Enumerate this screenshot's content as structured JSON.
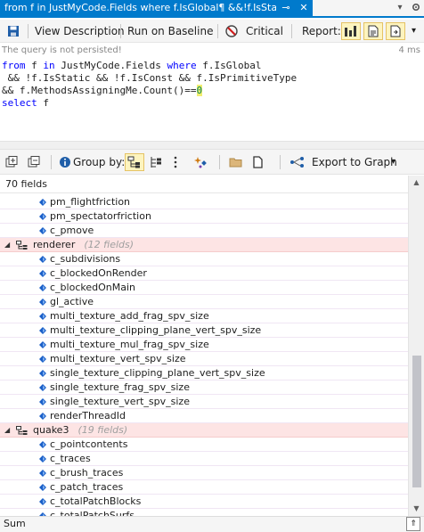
{
  "window": {
    "tab_title": "from f in JustMyCode.Fields where f.IsGlobal¶ &&!f.IsStati*",
    "pin_glyph": "⊸",
    "close_glyph": "✕"
  },
  "toolbar": {
    "view_description": "View Description",
    "run_on_baseline": "Run on Baseline",
    "critical": "Critical",
    "report_label": "Report:"
  },
  "status": {
    "message": "The query is not persisted!",
    "time": "4 ms"
  },
  "query": {
    "line1": {
      "kw1": "from",
      "a": " f ",
      "kw2": "in",
      "b": " JustMyCode.Fields ",
      "kw3": "where",
      "c": " f.IsGlobal"
    },
    "line2": " && !f.IsStatic && !f.IsConst && f.IsPrimitiveType",
    "line3": {
      "a": "&& f.MethodsAssigningMe.Count()==",
      "num": "0"
    },
    "line4": {
      "kw": "select",
      "a": " f"
    }
  },
  "results_toolbar": {
    "group_by": "Group by:",
    "export": "Export to Graph"
  },
  "grid": {
    "header": "70 fields",
    "rows": [
      {
        "type": "field",
        "name": "pm_flightfriction"
      },
      {
        "type": "field",
        "name": "pm_spectatorfriction"
      },
      {
        "type": "field",
        "name": "c_pmove"
      },
      {
        "type": "group",
        "name": "renderer",
        "count": "(12 fields)"
      },
      {
        "type": "field",
        "name": "c_subdivisions"
      },
      {
        "type": "field",
        "name": "c_blockedOnRender"
      },
      {
        "type": "field",
        "name": "c_blockedOnMain"
      },
      {
        "type": "field",
        "name": "gl_active"
      },
      {
        "type": "field",
        "name": "multi_texture_add_frag_spv_size"
      },
      {
        "type": "field",
        "name": "multi_texture_clipping_plane_vert_spv_size"
      },
      {
        "type": "field",
        "name": "multi_texture_mul_frag_spv_size"
      },
      {
        "type": "field",
        "name": "multi_texture_vert_spv_size"
      },
      {
        "type": "field",
        "name": "single_texture_clipping_plane_vert_spv_size"
      },
      {
        "type": "field",
        "name": "single_texture_frag_spv_size"
      },
      {
        "type": "field",
        "name": "single_texture_vert_spv_size"
      },
      {
        "type": "field",
        "name": "renderThreadId"
      },
      {
        "type": "group",
        "name": "quake3",
        "count": "(19 fields)"
      },
      {
        "type": "field",
        "name": "c_pointcontents"
      },
      {
        "type": "field",
        "name": "c_traces"
      },
      {
        "type": "field",
        "name": "c_brush_traces"
      },
      {
        "type": "field",
        "name": "c_patch_traces"
      },
      {
        "type": "field",
        "name": "c_totalPatchBlocks"
      },
      {
        "type": "field",
        "name": "c_totalPatchSurfs"
      }
    ]
  },
  "bottom": {
    "label": "Sum"
  },
  "colors": {
    "accent": "#007acc",
    "group_bg": "#fde4e4",
    "field_icon": "#1a5fc8"
  }
}
